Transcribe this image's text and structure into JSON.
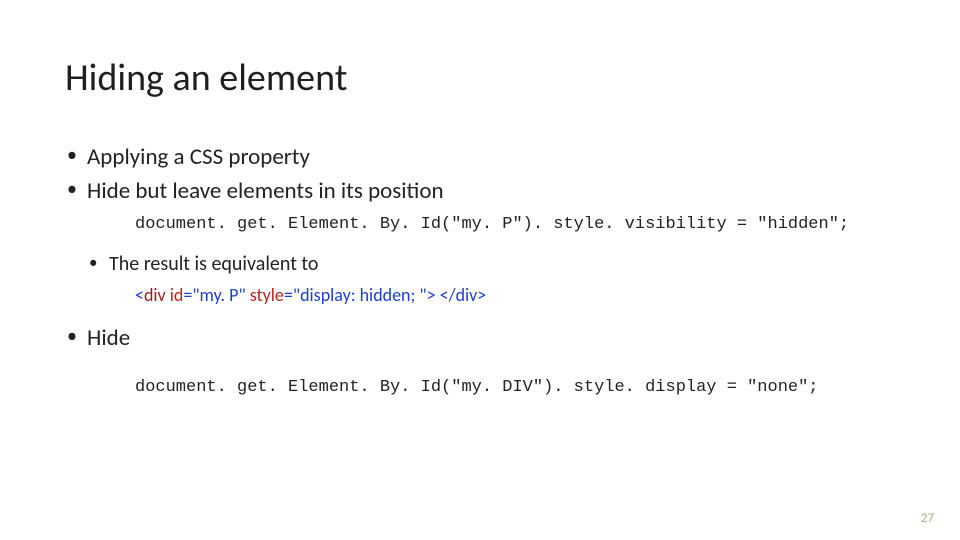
{
  "title": "Hiding an element",
  "bullets": {
    "b1": "Applying a CSS property",
    "b2": "Hide but leave elements in its position",
    "b3": "The result is equivalent to",
    "b4": "Hide"
  },
  "code1": "document. get. Element. By. Id(\"my. P\"). style. visibility = \"hidden\";",
  "code2": "document. get. Element. By. Id(\"my. DIV\"). style. display = \"none\";",
  "html_sample": {
    "lt1": "<",
    "div": "div ",
    "id_attr": "id",
    "eq1": "=\"",
    "id_val": "my. P",
    "q1": "\" ",
    "style_attr": "style",
    "eq2": "=\"",
    "style_val": "display: hidden; ",
    "q2": "\"> ",
    "close": "</div>"
  },
  "page_number": "27"
}
